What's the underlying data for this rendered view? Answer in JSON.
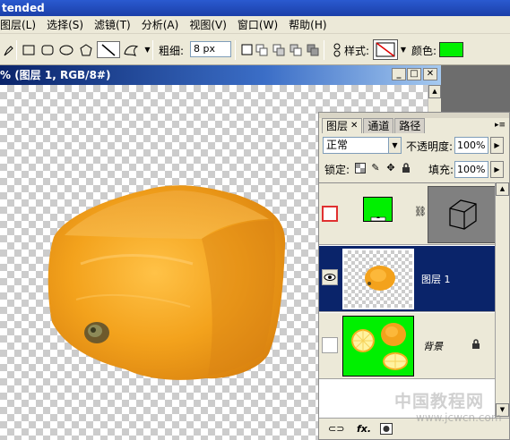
{
  "app": {
    "title": "tended"
  },
  "menu": [
    "图层(L)",
    "选择(S)",
    "滤镜(T)",
    "分析(A)",
    "视图(V)",
    "窗口(W)",
    "帮助(H)"
  ],
  "options": {
    "weight_label": "粗细:",
    "weight_value": "8 px",
    "style_label": "样式:",
    "color_label": "颜色:",
    "color_value": "#00f000"
  },
  "document": {
    "title": "% (图层 1, RGB/8#)"
  },
  "layers_panel": {
    "tabs": [
      {
        "label": "图层",
        "active": true
      },
      {
        "label": "通道",
        "active": false
      },
      {
        "label": "路径",
        "active": false
      }
    ],
    "blend_mode": "正常",
    "opacity_label": "不透明度:",
    "opacity_value": "100%",
    "lock_label": "锁定:",
    "fill_label": "填充:",
    "fill_value": "100%",
    "layers": [
      {
        "name": "",
        "type": "adjustment",
        "visible": false
      },
      {
        "name": "图层 1",
        "type": "normal",
        "visible": true,
        "selected": true
      },
      {
        "name": "背景",
        "type": "background",
        "visible": false,
        "locked": true
      }
    ]
  },
  "watermark": {
    "text": "中国教程网",
    "url": "www.jcwcn.com"
  }
}
